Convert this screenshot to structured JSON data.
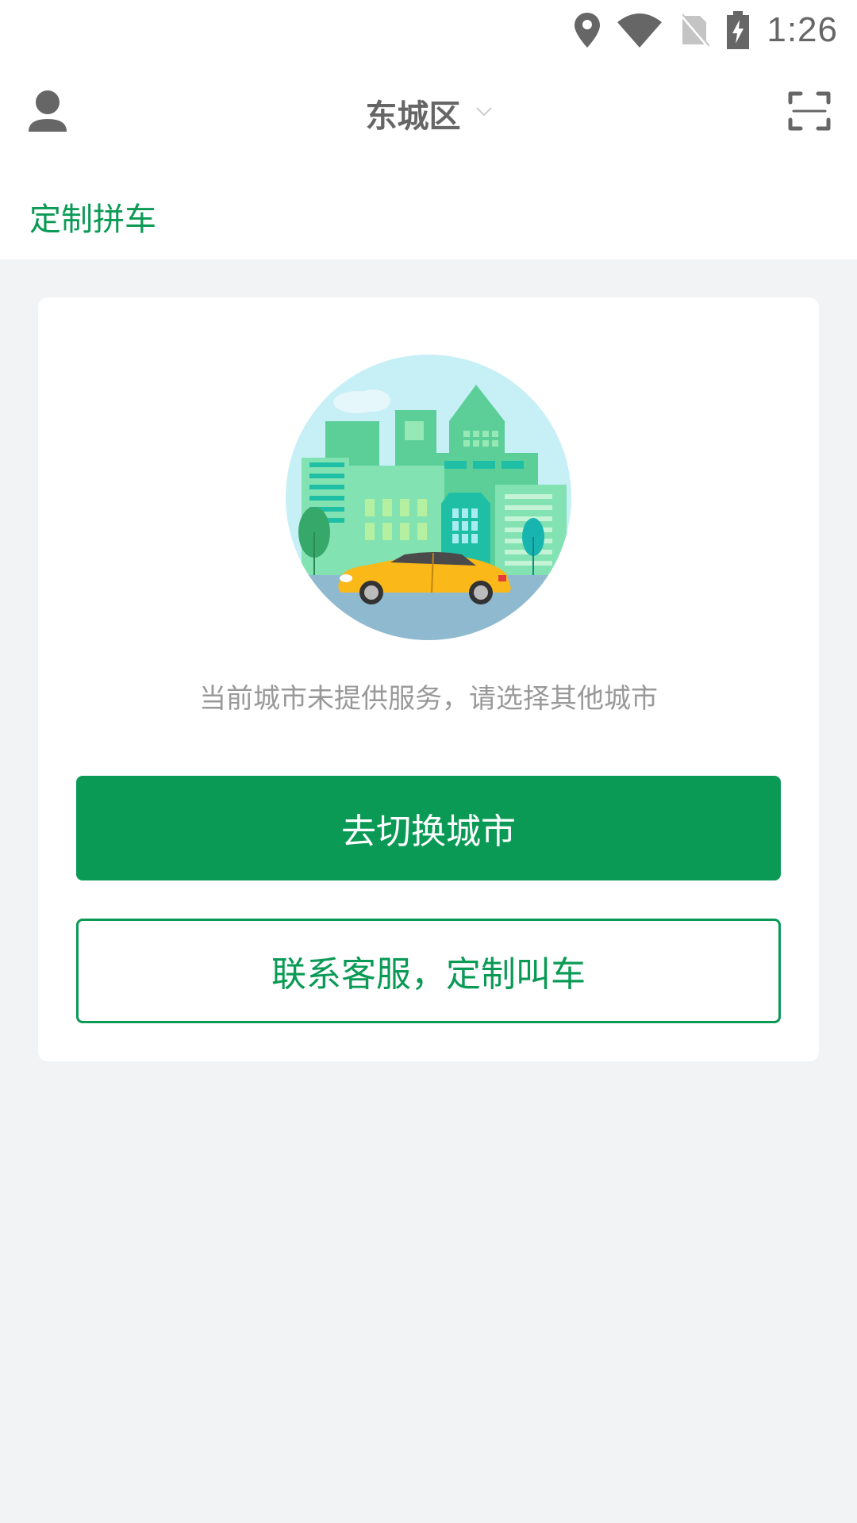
{
  "status_bar": {
    "time": "1:26",
    "icons": [
      "location-icon",
      "wifi-icon",
      "no-sim-icon",
      "battery-charging-icon"
    ]
  },
  "header": {
    "city": "东城区",
    "left_icon": "user-icon",
    "right_icon": "scan-icon",
    "dropdown_icon": "chevron-down-icon"
  },
  "tab": {
    "label": "定制拼车"
  },
  "card": {
    "illustration": "city-taxi-illustration",
    "notice": "当前城市未提供服务，请选择其他城市",
    "primary_button": "去切换城市",
    "secondary_button": "联系客服，定制叫车"
  },
  "colors": {
    "brand_green": "#0a9a55",
    "page_background": "#f2f3f5",
    "icon_gray": "#666666",
    "notice_gray": "#999999"
  }
}
